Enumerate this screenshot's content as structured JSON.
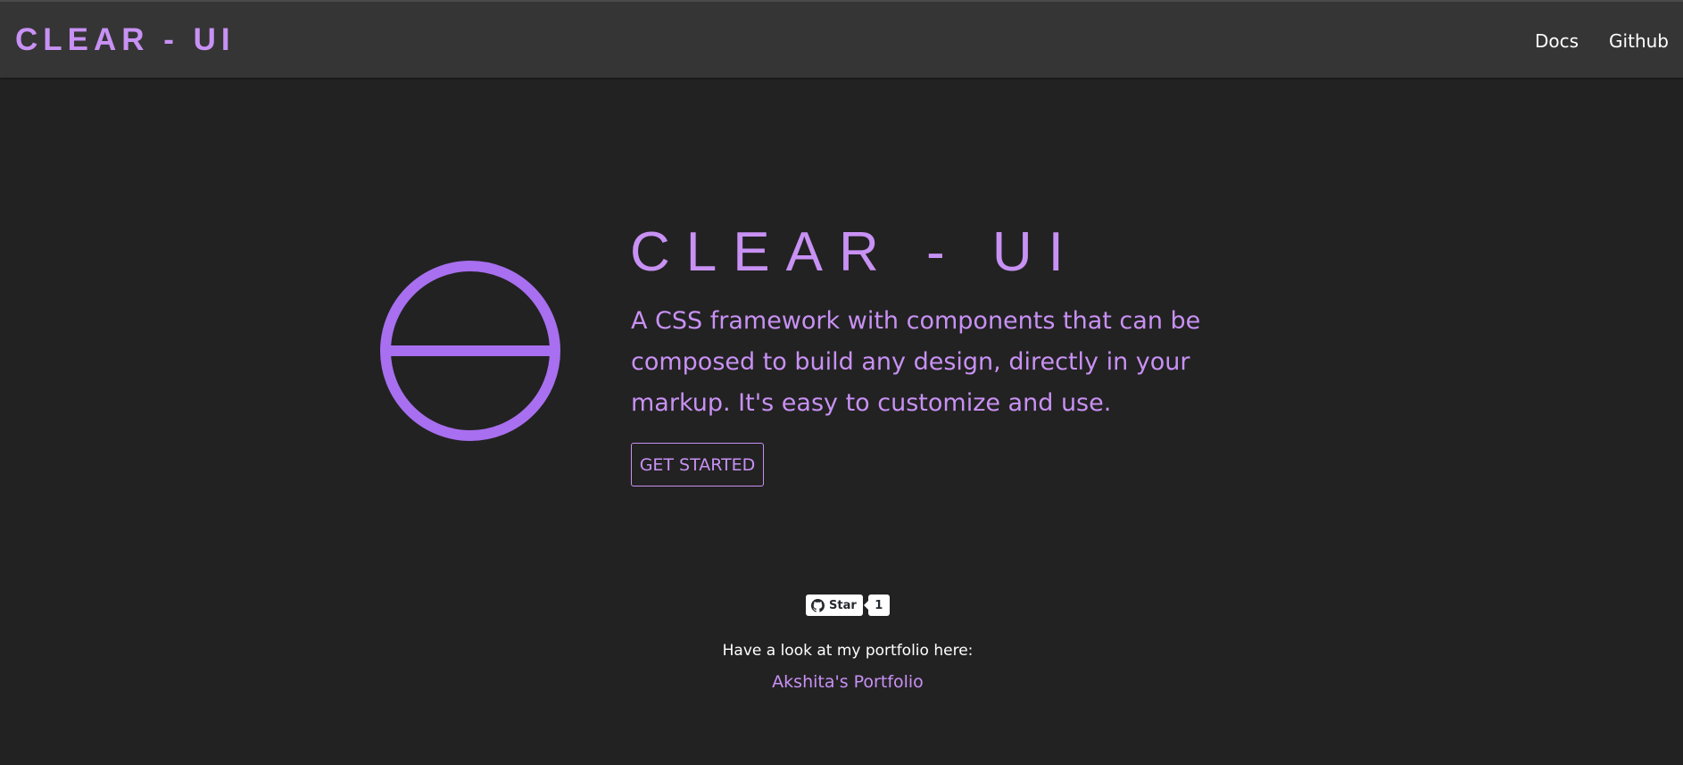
{
  "navbar": {
    "brand": "CLEAR - UI",
    "links": [
      {
        "label": "Docs"
      },
      {
        "label": "Github"
      }
    ]
  },
  "hero": {
    "logo_icon": "circle-with-horizontal-bar-icon",
    "title": "CLEAR - UI",
    "description": "A CSS framework with components that can be composed to build any design, directly in your markup. It's easy to customize and use.",
    "cta_label": "GET STARTED"
  },
  "github_star": {
    "icon": "github-icon",
    "label": "Star",
    "count": "1"
  },
  "portfolio": {
    "text": "Have a look at my portfolio here:",
    "link_label": "Akshita's Portfolio"
  },
  "colors": {
    "accent": "#c891f4",
    "logo": "#a86ff0",
    "background": "#222222",
    "navbar": "#353535"
  }
}
